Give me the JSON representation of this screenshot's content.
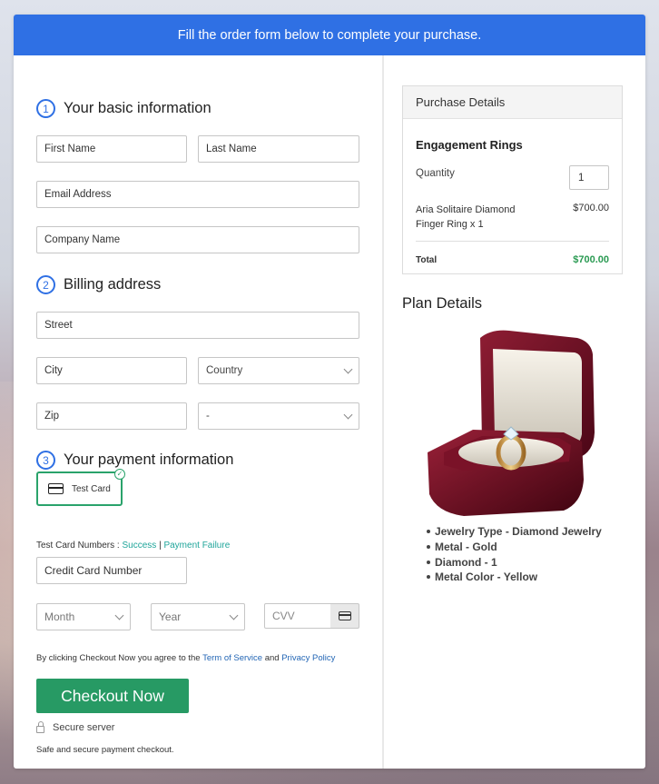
{
  "banner": {
    "text": "Fill the order form below to complete your purchase."
  },
  "basic": {
    "step": "1",
    "title": "Your basic information",
    "first_name_placeholder": "First Name",
    "last_name_placeholder": "Last Name",
    "email_placeholder": "Email Address",
    "company_placeholder": "Company Name"
  },
  "billing": {
    "step": "2",
    "title": "Billing address",
    "street_placeholder": "Street",
    "city_placeholder": "City",
    "country_select": "Country",
    "zip_placeholder": "Zip",
    "state_select": "-"
  },
  "payment": {
    "step": "3",
    "title": "Your payment information",
    "method_label": "Test Card",
    "test_numbers_label": "Test Card Numbers :",
    "success_link": "Success",
    "separator": "|",
    "failure_link": "Payment Failure",
    "card_number_placeholder": "Credit Card Number",
    "month_select": "Month",
    "year_select": "Year",
    "cvv_placeholder": "CVV"
  },
  "agreement": {
    "prefix": "By clicking Checkout Now you agree to the",
    "terms_link": "Term of Service",
    "and": "and",
    "privacy_link": "Privacy Policy"
  },
  "checkout": {
    "button_label": "Checkout Now",
    "secure_label": "Secure server",
    "safe_note": "Safe and secure payment checkout."
  },
  "purchase": {
    "header": "Purchase Details",
    "product": "Engagement Rings",
    "quantity_label": "Quantity",
    "quantity_value": "1",
    "item_name": "Aria Solitaire Diamond Finger Ring x 1",
    "item_price": "$700.00",
    "total_label": "Total",
    "total_value": "$700.00"
  },
  "plan": {
    "title": "Plan Details",
    "features": [
      "Jewelry Type - Diamond Jewelry",
      "Metal - Gold",
      "Diamond - 1",
      "Metal Color - Yellow"
    ]
  },
  "colors": {
    "banner": "#2f70e4",
    "checkout_button": "#279a64",
    "total_green": "#2a9a52",
    "link_green": "#1fa59a",
    "link_blue": "#2366b5"
  }
}
